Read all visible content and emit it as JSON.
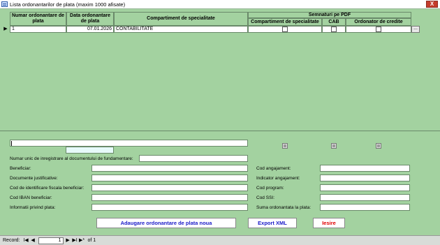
{
  "window": {
    "title": "Lista ordonantarilor de plata (maxim 1000 afisate)",
    "close_label": "X"
  },
  "grid": {
    "headers": {
      "numar": "Numar ordonantare de plata",
      "data": "Data ordonantare de plata",
      "compartiment": "Compartiment de specialitate",
      "semnaturi": "Semnaturi pe PDF",
      "sem_compartiment": "Compartiment de specialitate",
      "sem_cab": "CAB",
      "sem_ordonator": "Ordonator de credite"
    },
    "rows": [
      {
        "selector": "▶",
        "numar": "1",
        "data": "07.01.2026",
        "compartiment": "CONTABILITATE",
        "sem_compartiment": false,
        "sem_cab": false,
        "sem_ordonator": false
      }
    ],
    "ellipsis_label": "..."
  },
  "form": {
    "numar_unic_label": "Numar unic de inregistrare al documentului de fundamentare:",
    "beneficiar_label": "Beneficiar:",
    "documente_label": "Documente justificative:",
    "cif_label": "Cod de identificare fiscala beneficiar:",
    "iban_label": "Cod IBAN beneficiar:",
    "informatii_label": "Informatii privind plata:",
    "cod_angajament_label": "Cod angajament:",
    "indicator_label": "Indicator angajament:",
    "cod_program_label": "Cod program:",
    "cod_ssi_label": "Cod SSI:",
    "suma_label": "Suma ordonantata la plata:"
  },
  "buttons": {
    "add": "Adaugare ordonantare de plata noua",
    "export": "Export XML",
    "exit": "Iesire"
  },
  "colors": {
    "add": "#1a1ac8",
    "export": "#1a1ac8",
    "exit": "#e00000"
  },
  "status": {
    "record_label": "Record:",
    "first": "I◀",
    "prev": "◀",
    "current": "1",
    "next": "▶",
    "last": "▶I",
    "new": "▶*",
    "of_label": "of 1"
  }
}
